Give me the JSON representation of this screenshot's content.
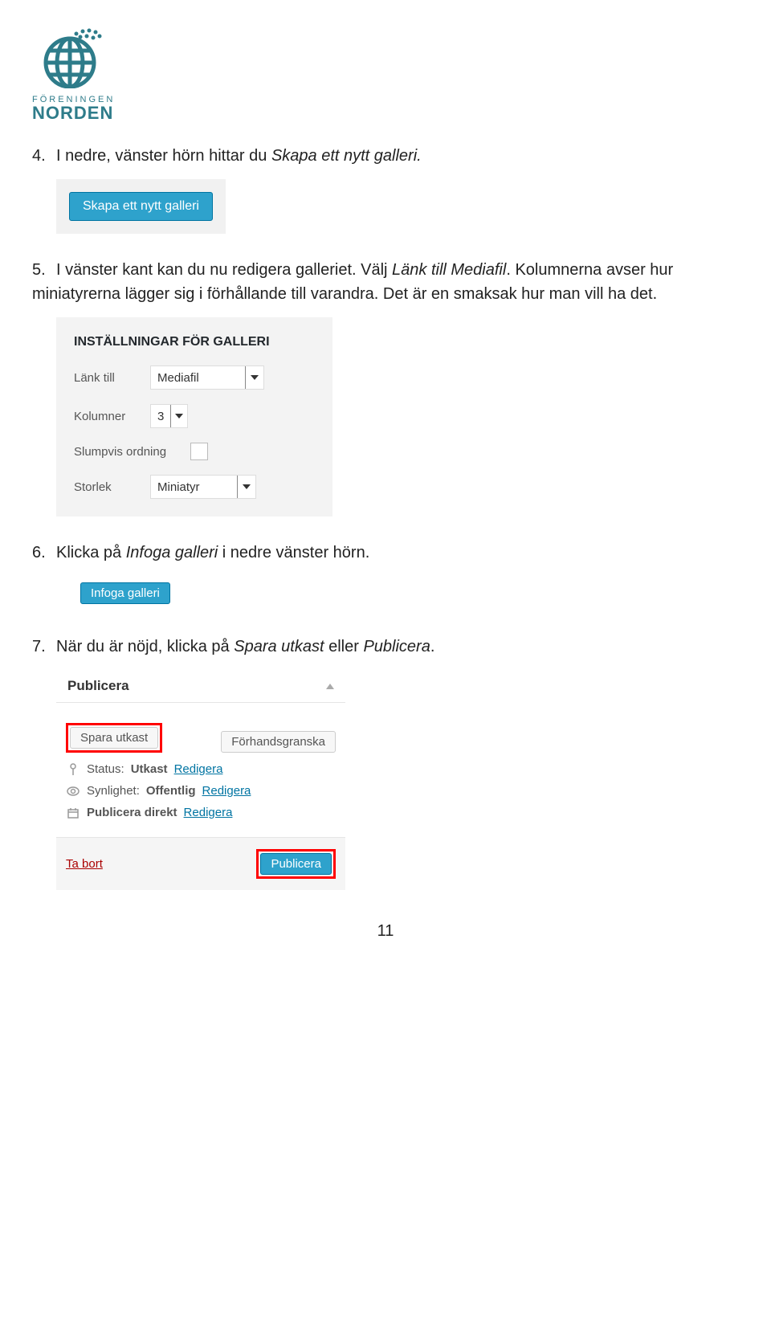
{
  "logo": {
    "subtitle": "FÖRENINGEN",
    "title": "NORDEN"
  },
  "step4": {
    "num": "4.",
    "pre": "I nedre, vänster hörn hittar du ",
    "em": "Skapa ett nytt galleri."
  },
  "btn_create": "Skapa ett nytt galleri",
  "step5": {
    "num": "5.",
    "line1a": "I vänster kant kan du nu redigera galleriet. Välj ",
    "line1em": "Länk till Mediafil",
    "line1b": ". Kolumnerna avser hur miniatyrerna lägger sig i förhållande till varandra. Det är en smaksak hur man vill ha det."
  },
  "settings": {
    "title": "INSTÄLLNINGAR FÖR GALLERI",
    "link_label": "Länk till",
    "link_value": "Mediafil",
    "cols_label": "Kolumner",
    "cols_value": "3",
    "random_label": "Slumpvis ordning",
    "size_label": "Storlek",
    "size_value": "Miniatyr"
  },
  "step6": {
    "num": "6.",
    "pre": "Klicka på ",
    "em": "Infoga galleri",
    "post": " i nedre vänster hörn."
  },
  "btn_insert": "Infoga galleri",
  "step7": {
    "num": "7.",
    "pre": "När du är nöjd, klicka på ",
    "em1": "Spara utkast",
    "mid": " eller ",
    "em2": "Publicera"
  },
  "publish": {
    "title": "Publicera",
    "save_draft": "Spara utkast",
    "preview": "Förhandsgranska",
    "status_label": "Status:",
    "status_value": "Utkast",
    "visibility_label": "Synlighet:",
    "visibility_value": "Offentlig",
    "schedule_label": "Publicera direkt",
    "edit": "Redigera",
    "delete": "Ta bort",
    "publish_btn": "Publicera"
  },
  "pagenum": "11"
}
